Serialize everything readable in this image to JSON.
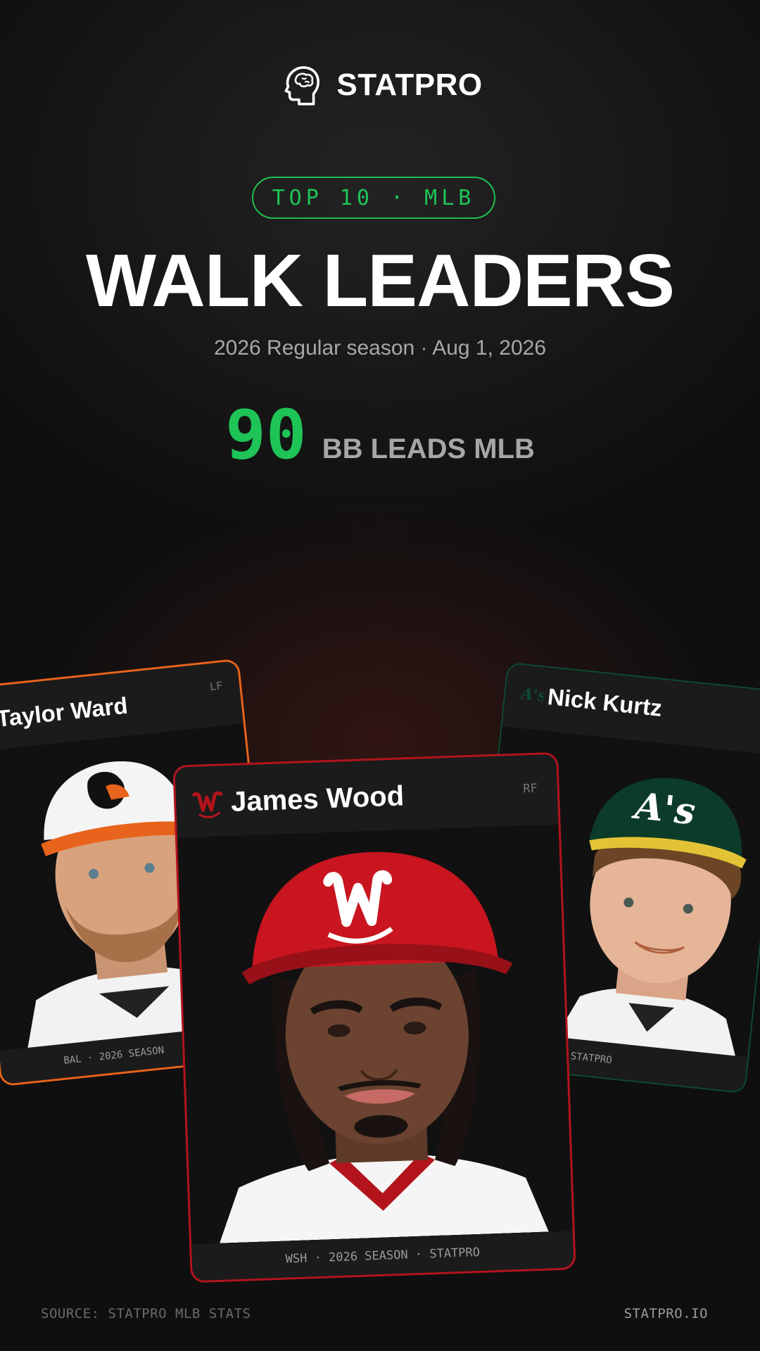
{
  "brand": {
    "name": "STATPRO",
    "logo_icon": "brain-head-icon"
  },
  "badge": {
    "label": "TOP 10 · MLB"
  },
  "headline": {
    "title": "WALK LEADERS",
    "subtitle": "2026 Regular season · Aug 1, 2026"
  },
  "lead_stat": {
    "value": "90",
    "label": "BB LEADS MLB"
  },
  "cards": {
    "left": {
      "name": "Taylor Ward",
      "position": "LF",
      "footer": "BAL · 2026 SEASON",
      "team_icon": "orioles-logo-icon",
      "accent": "#e8631c"
    },
    "center": {
      "name": "James Wood",
      "position": "RF",
      "footer": "WSH · 2026 SEASON · STATPRO",
      "team_icon": "nationals-logo-icon",
      "accent": "#b3141c"
    },
    "right": {
      "name": "Nick Kurtz",
      "footer": "SEASON · STATPRO",
      "team_icon": "athletics-logo-icon",
      "accent": "#0c4a34"
    }
  },
  "footer": {
    "source": "SOURCE: STATPRO MLB STATS",
    "site": "STATPRO.IO"
  },
  "colors": {
    "accent_green": "#1fc457",
    "background": "#0f0f0f"
  }
}
